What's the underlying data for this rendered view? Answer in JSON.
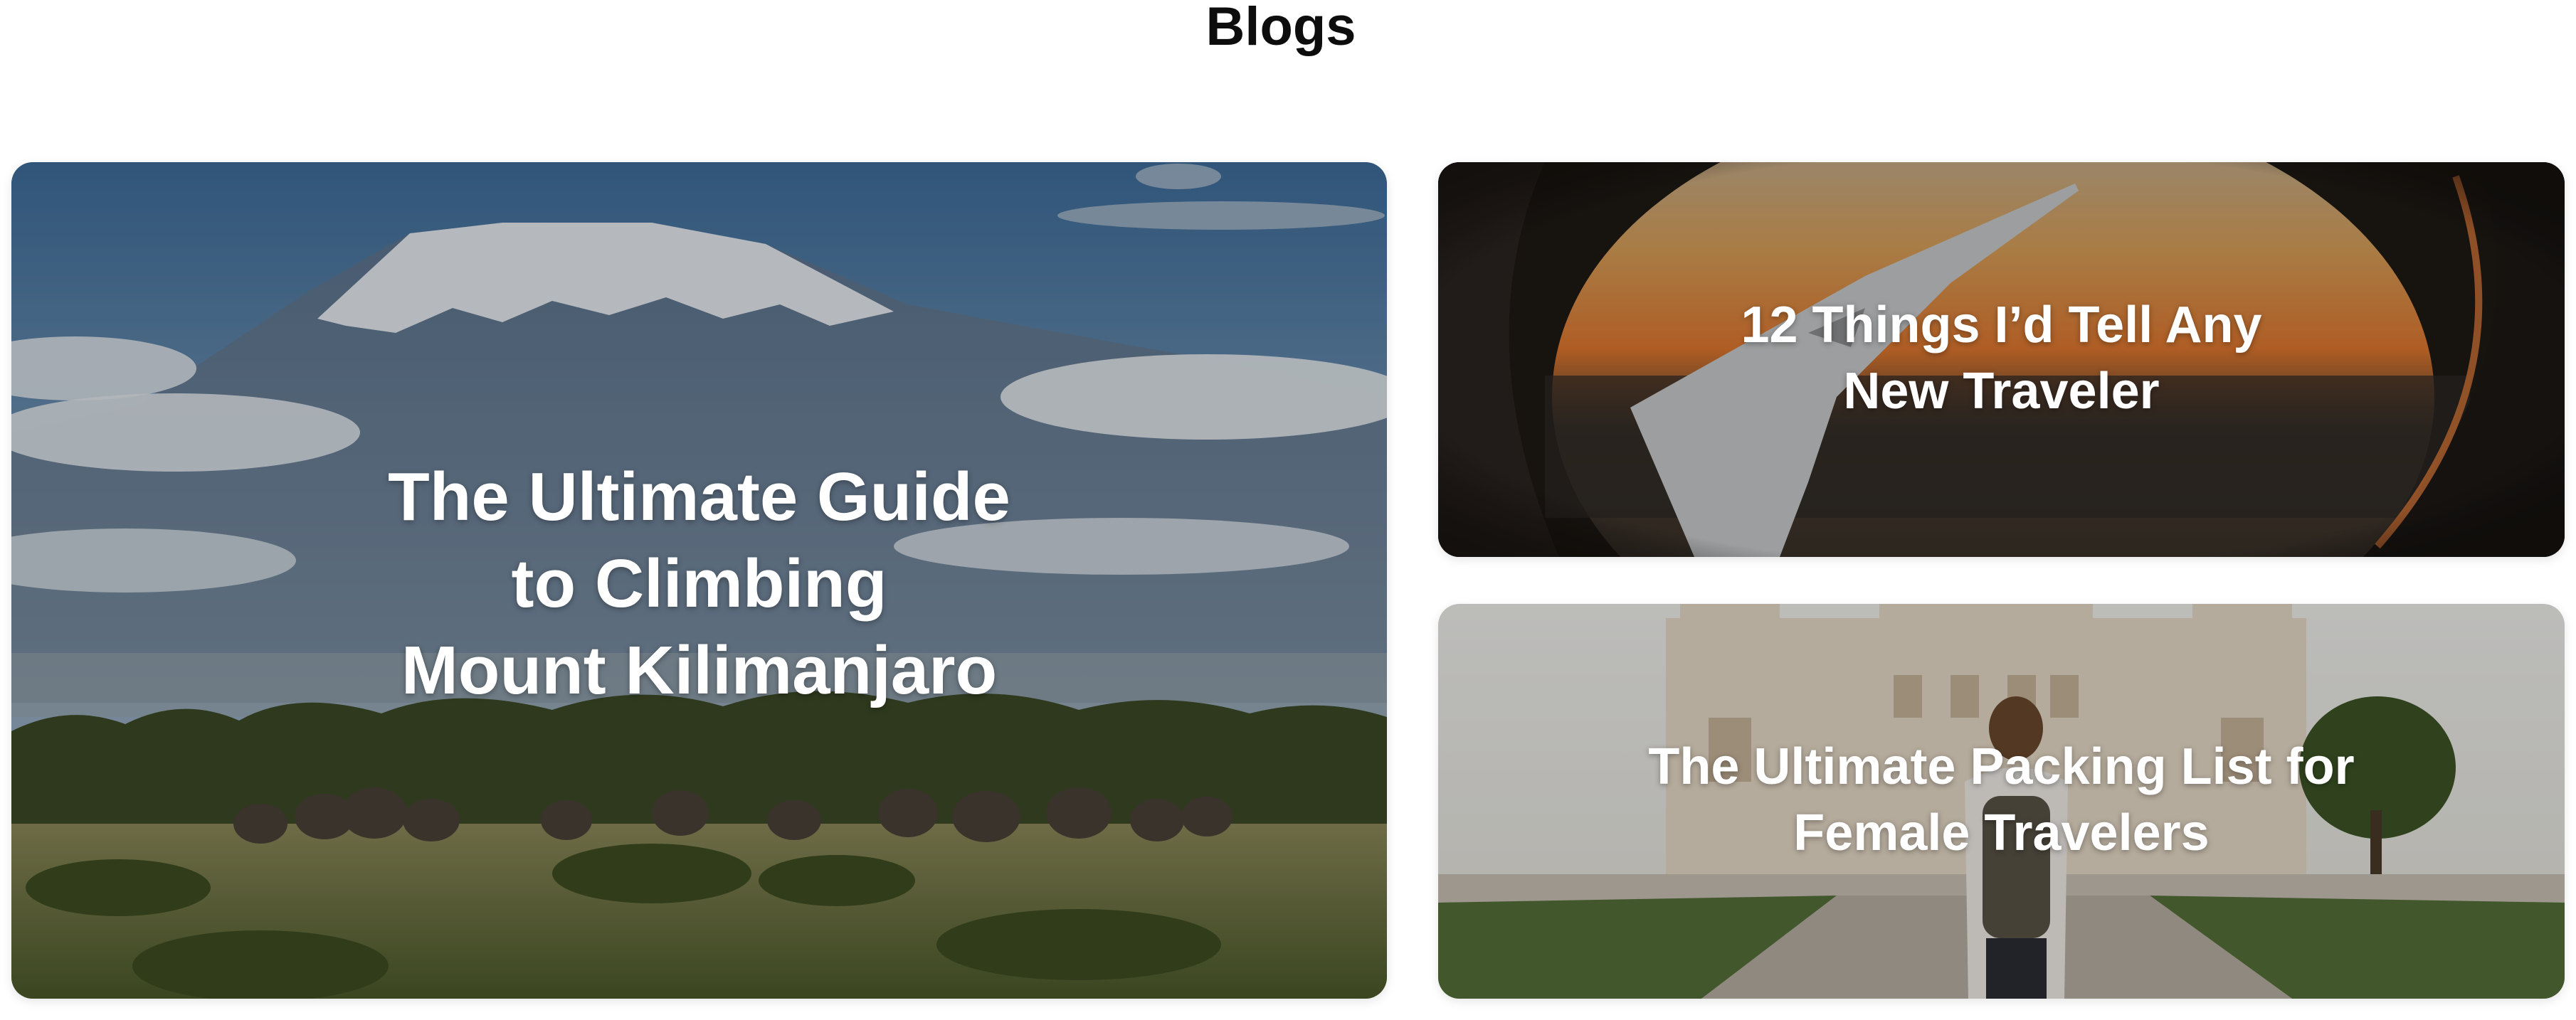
{
  "page": {
    "title": "Blogs"
  },
  "cards": [
    {
      "title": "The Ultimate Guide\nto Climbing\nMount Kilimanjaro",
      "image": "mount-kilimanjaro-elephants-photo"
    },
    {
      "title": "12 Things I’d Tell Any\nNew Traveler",
      "image": "airplane-window-sunset-photo"
    },
    {
      "title": "The Ultimate Packing List for\nFemale Travelers",
      "image": "traveler-with-backpack-palace-photo"
    }
  ],
  "colors": {
    "title_text": "#0d0d0d",
    "card_text": "#ffffff",
    "sky_blue": "#4f7aa6",
    "savanna_green": "#5e6a3c",
    "sunset_orange": "#e07a3a"
  }
}
